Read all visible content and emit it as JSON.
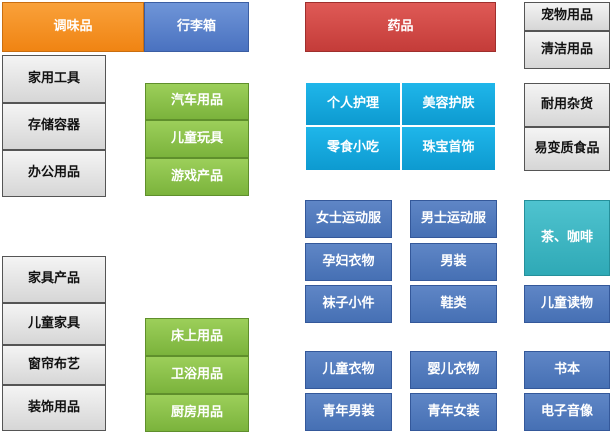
{
  "categories": {
    "seasoning": "调味品",
    "luggage": "行李箱",
    "medicine": "药品",
    "pet_supplies": "宠物用品",
    "cleaning_supplies": "清洁用品",
    "household_tools": "家用工具",
    "storage_containers": "存储容器",
    "office_supplies": "办公用品",
    "car_supplies": "汽车用品",
    "kids_toys": "儿童玩具",
    "game_products": "游戏产品",
    "personal_care": "个人护理",
    "beauty_skincare": "美容护肤",
    "snacks": "零食小吃",
    "jewelry": "珠宝首饰",
    "durable_goods": "耐用杂货",
    "perishable_food": "易变质食品",
    "womens_sportswear": "女士运动服",
    "mens_sportswear": "男士运动服",
    "tea_coffee": "茶、咖啡",
    "maternity_wear": "孕妇衣物",
    "menswear": "男装",
    "socks_accessories": "袜子小件",
    "shoes": "鞋类",
    "kids_books": "儿童读物",
    "furniture": "家具产品",
    "kids_furniture": "儿童家具",
    "curtains_fabric": "窗帘布艺",
    "decor": "装饰用品",
    "bedding": "床上用品",
    "bath": "卫浴用品",
    "kitchen": "厨房用品",
    "kids_clothing": "儿童衣物",
    "baby_clothing": "婴儿衣物",
    "books": "书本",
    "young_men": "青年男装",
    "young_women": "青年女装",
    "electronics_audio": "电子音像"
  },
  "colors": {
    "orange": "#f08413",
    "blue": "#4a72c0",
    "red": "#c43c39",
    "gray": "#d6d6d6",
    "green": "#7bb33c",
    "cyan": "#0d9ad0",
    "steel": "#4670b4",
    "teal": "#2fa9b6"
  }
}
